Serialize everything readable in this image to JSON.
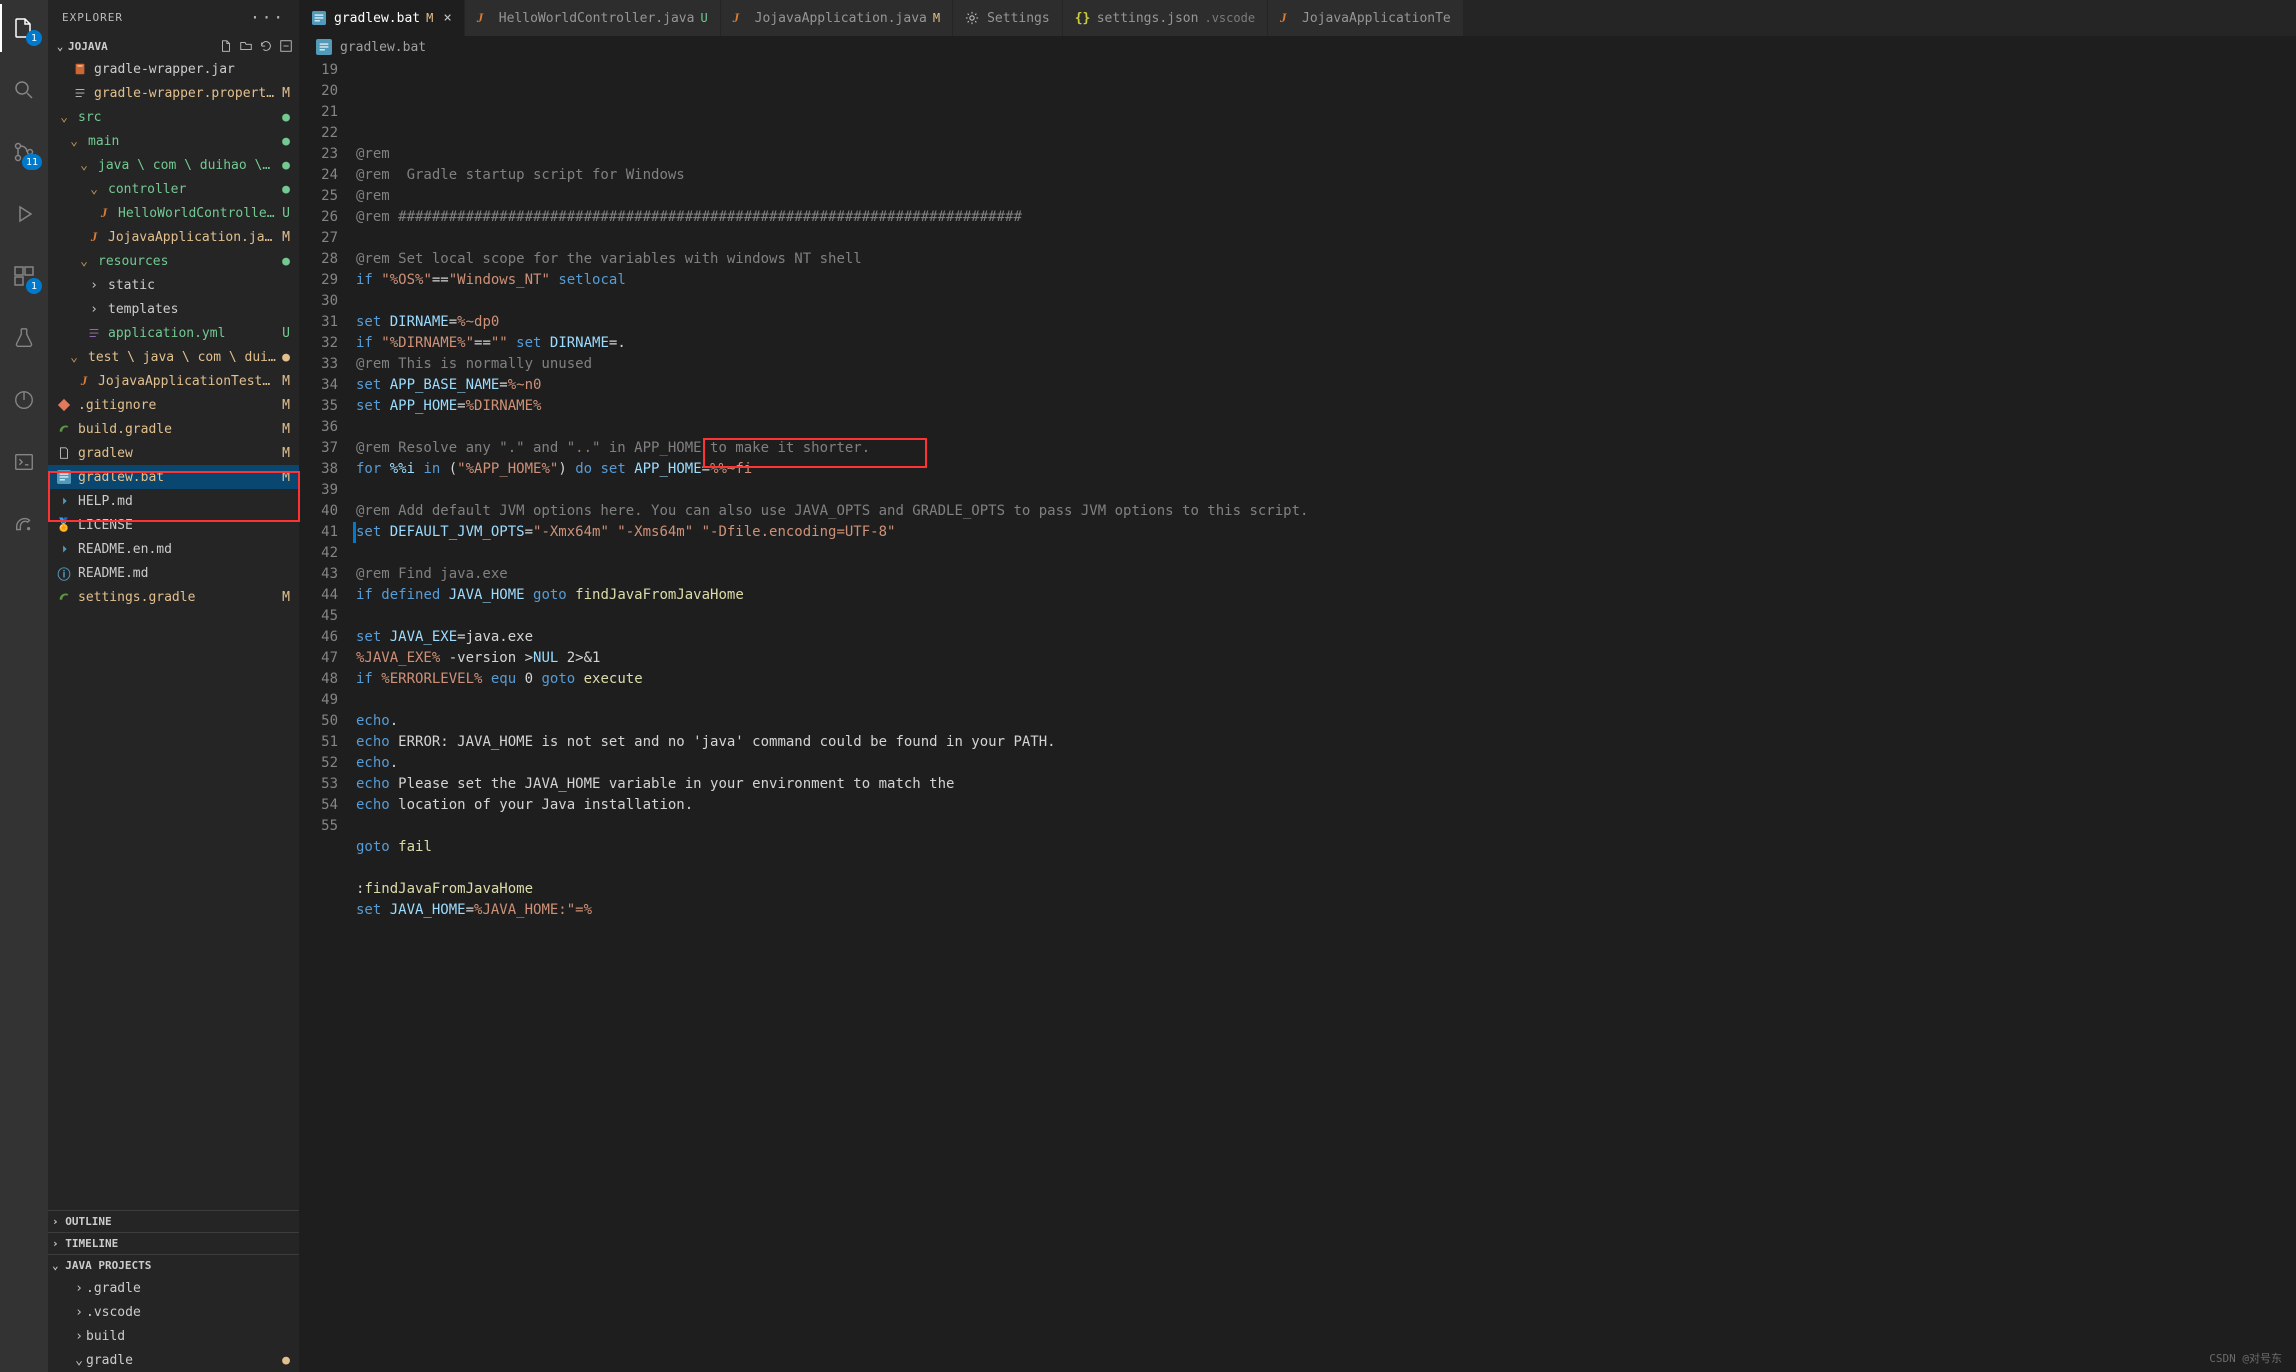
{
  "sidebar": {
    "title": "EXPLORER",
    "root": "JOJAVA",
    "tree": [
      {
        "label": "gradle-wrapper.jar",
        "icon": "jar",
        "status": "",
        "cls": ""
      },
      {
        "label": "gradle-wrapper.properties",
        "icon": "props",
        "status": "M",
        "cls": "file-yellow"
      },
      {
        "label": "src",
        "icon": "folder-o",
        "status": "dotA",
        "cls": "folder-name green"
      },
      {
        "label": "main",
        "icon": "folder-o",
        "status": "dotA",
        "cls": "folder-name green"
      },
      {
        "label": "java \\ com \\ duihao \\ joja...",
        "icon": "folder-o",
        "status": "dotA",
        "cls": "folder-name green"
      },
      {
        "label": "controller",
        "icon": "folder-o",
        "status": "dotA",
        "cls": "folder-name green"
      },
      {
        "label": "HelloWorldController....",
        "icon": "java",
        "status": "U",
        "cls": "file-green"
      },
      {
        "label": "JojavaApplication.java",
        "icon": "java",
        "status": "M",
        "cls": "file-yellow"
      },
      {
        "label": "resources",
        "icon": "folder-o",
        "status": "dotA",
        "cls": "folder-name green"
      },
      {
        "label": "static",
        "icon": "folder-c",
        "status": "",
        "cls": ""
      },
      {
        "label": "templates",
        "icon": "folder-c",
        "status": "",
        "cls": ""
      },
      {
        "label": "application.yml",
        "icon": "yml",
        "status": "U",
        "cls": "file-green"
      },
      {
        "label": "test \\ java \\ com \\ duihao \\ ...",
        "icon": "folder-o",
        "status": "dotM",
        "cls": "folder-name yellow"
      },
      {
        "label": "JojavaApplicationTests.j...",
        "icon": "java",
        "status": "M",
        "cls": "file-yellow"
      },
      {
        "label": ".gitignore",
        "icon": "git",
        "status": "M",
        "cls": "file-yellow"
      },
      {
        "label": "build.gradle",
        "icon": "gradle",
        "status": "M",
        "cls": "file-yellow"
      },
      {
        "label": "gradlew",
        "icon": "file",
        "status": "M",
        "cls": "file-yellow"
      },
      {
        "label": "gradlew.bat",
        "icon": "bat",
        "status": "M",
        "cls": "file-yellow",
        "selected": true
      },
      {
        "label": "HELP.md",
        "icon": "md",
        "status": "",
        "cls": ""
      },
      {
        "label": "LICENSE",
        "icon": "lic",
        "status": "",
        "cls": ""
      },
      {
        "label": "README.en.md",
        "icon": "md",
        "status": "",
        "cls": ""
      },
      {
        "label": "README.md",
        "icon": "md-i",
        "status": "",
        "cls": ""
      },
      {
        "label": "settings.gradle",
        "icon": "gradle",
        "status": "M",
        "cls": "file-yellow"
      }
    ],
    "panels": [
      "OUTLINE",
      "TIMELINE",
      "JAVA PROJECTS"
    ],
    "java_projects": [
      ".gradle",
      ".vscode",
      "build",
      "gradle"
    ]
  },
  "tabs": [
    {
      "icon": "bat",
      "label": "gradlew.bat",
      "git": "M",
      "active": true,
      "close": true
    },
    {
      "icon": "java",
      "label": "HelloWorldController.java",
      "git": "U"
    },
    {
      "icon": "java",
      "label": "JojavaApplication.java",
      "git": "M"
    },
    {
      "icon": "gear",
      "label": "Settings"
    },
    {
      "icon": "json",
      "label": "settings.json",
      "suffix": ".vscode"
    },
    {
      "icon": "java",
      "label": "JojavaApplicationTe"
    }
  ],
  "breadcrumb": {
    "icon": "bat",
    "label": "gradlew.bat"
  },
  "code": {
    "start": 19,
    "lines": [
      [
        [
          "@rem",
          "tk-rem"
        ]
      ],
      [
        [
          "@rem",
          "tk-rem"
        ],
        [
          "  Gradle startup script for Windows",
          "tk-rem-h"
        ]
      ],
      [
        [
          "@rem",
          "tk-rem"
        ]
      ],
      [
        [
          "@rem",
          "tk-rem"
        ],
        [
          " ##########################################################################",
          "tk-rem-h"
        ]
      ],
      [
        [
          "",
          "tk-plain"
        ]
      ],
      [
        [
          "@rem",
          "tk-rem"
        ],
        [
          " Set local scope for the variables with windows NT shell",
          "tk-rem-h"
        ]
      ],
      [
        [
          "if ",
          "tk-kw"
        ],
        [
          "\"%OS%\"",
          "tk-str"
        ],
        [
          "==",
          "tk-plain"
        ],
        [
          "\"Windows_NT\"",
          "tk-str"
        ],
        [
          " setlocal",
          "tk-kw"
        ]
      ],
      [
        [
          "",
          "tk-plain"
        ]
      ],
      [
        [
          "set ",
          "tk-kw"
        ],
        [
          "DIRNAME",
          "tk-var"
        ],
        [
          "=",
          "tk-plain"
        ],
        [
          "%~dp0",
          "tk-str"
        ]
      ],
      [
        [
          "if ",
          "tk-kw"
        ],
        [
          "\"%DIRNAME%\"",
          "tk-str"
        ],
        [
          "==",
          "tk-plain"
        ],
        [
          "\"\"",
          "tk-str"
        ],
        [
          " set ",
          "tk-kw"
        ],
        [
          "DIRNAME",
          "tk-var"
        ],
        [
          "=.",
          "tk-plain"
        ]
      ],
      [
        [
          "@rem",
          "tk-rem"
        ],
        [
          " This is normally unused",
          "tk-rem-h"
        ]
      ],
      [
        [
          "set ",
          "tk-kw"
        ],
        [
          "APP_BASE_NAME",
          "tk-var"
        ],
        [
          "=",
          "tk-plain"
        ],
        [
          "%~n0",
          "tk-str"
        ]
      ],
      [
        [
          "set ",
          "tk-kw"
        ],
        [
          "APP_HOME",
          "tk-var"
        ],
        [
          "=",
          "tk-plain"
        ],
        [
          "%DIRNAME%",
          "tk-str"
        ]
      ],
      [
        [
          "",
          "tk-plain"
        ]
      ],
      [
        [
          "@rem",
          "tk-rem"
        ],
        [
          " Resolve any \".\" and \"..\" in APP_HOME to make it shorter.",
          "tk-rem-h"
        ]
      ],
      [
        [
          "for ",
          "tk-kw"
        ],
        [
          "%%i",
          "tk-var"
        ],
        [
          " in ",
          "tk-kw"
        ],
        [
          "(",
          "tk-plain"
        ],
        [
          "\"%APP_HOME%\"",
          "tk-str"
        ],
        [
          ") ",
          "tk-plain"
        ],
        [
          "do ",
          "tk-kw"
        ],
        [
          "set ",
          "tk-kw"
        ],
        [
          "APP_HOME",
          "tk-var"
        ],
        [
          "=",
          "tk-plain"
        ],
        [
          "%%~fi",
          "tk-str"
        ]
      ],
      [
        [
          "",
          "tk-plain"
        ]
      ],
      [
        [
          "@rem",
          "tk-rem"
        ],
        [
          " Add default JVM options here. You can also use JAVA_OPTS and GRADLE_OPTS to pass JVM options to this script.",
          "tk-rem-h"
        ]
      ],
      [
        [
          "set ",
          "tk-kw"
        ],
        [
          "DEFAULT_JVM_OPTS",
          "tk-var"
        ],
        [
          "=",
          "tk-plain"
        ],
        [
          "\"-Xmx64m\" \"-Xms64m\" \"-Dfile.encoding=UTF-8\"",
          "tk-str"
        ]
      ],
      [
        [
          "",
          "tk-plain"
        ]
      ],
      [
        [
          "@rem",
          "tk-rem"
        ],
        [
          " Find java.exe",
          "tk-rem-h"
        ]
      ],
      [
        [
          "if ",
          "tk-kw"
        ],
        [
          "defined ",
          "tk-kw"
        ],
        [
          "JAVA_HOME",
          "tk-var"
        ],
        [
          " goto ",
          "tk-kw"
        ],
        [
          "findJavaFromJavaHome",
          "tk-fn"
        ]
      ],
      [
        [
          "",
          "tk-plain"
        ]
      ],
      [
        [
          "set ",
          "tk-kw"
        ],
        [
          "JAVA_EXE",
          "tk-var"
        ],
        [
          "=java.exe",
          "tk-plain"
        ]
      ],
      [
        [
          "%JAVA_EXE%",
          "tk-str"
        ],
        [
          " -version >",
          "tk-plain"
        ],
        [
          "NUL",
          "tk-var"
        ],
        [
          " 2>&1",
          "tk-plain"
        ]
      ],
      [
        [
          "if ",
          "tk-kw"
        ],
        [
          "%ERRORLEVEL%",
          "tk-str"
        ],
        [
          " equ ",
          "tk-kw"
        ],
        [
          "0",
          "tk-plain"
        ],
        [
          " goto ",
          "tk-kw"
        ],
        [
          "execute",
          "tk-fn"
        ]
      ],
      [
        [
          "",
          "tk-plain"
        ]
      ],
      [
        [
          "echo",
          "tk-kw"
        ],
        [
          ".",
          "tk-plain"
        ]
      ],
      [
        [
          "echo ",
          "tk-kw"
        ],
        [
          "ERROR: JAVA_HOME is not set and no 'java' command could be found in your PATH.",
          "tk-plain"
        ]
      ],
      [
        [
          "echo",
          "tk-kw"
        ],
        [
          ".",
          "tk-plain"
        ]
      ],
      [
        [
          "echo ",
          "tk-kw"
        ],
        [
          "Please set the JAVA_HOME variable in your environment to match the",
          "tk-plain"
        ]
      ],
      [
        [
          "echo ",
          "tk-kw"
        ],
        [
          "location of your Java installation.",
          "tk-plain"
        ]
      ],
      [
        [
          "",
          "tk-plain"
        ]
      ],
      [
        [
          "goto ",
          "tk-kw"
        ],
        [
          "fail",
          "tk-fn"
        ]
      ],
      [
        [
          "",
          "tk-plain"
        ]
      ],
      [
        [
          ":",
          "tk-plain"
        ],
        [
          "findJavaFromJavaHome",
          "tk-fn"
        ]
      ],
      [
        [
          "set ",
          "tk-kw"
        ],
        [
          "JAVA_HOME",
          "tk-var"
        ],
        [
          "=",
          "tk-plain"
        ],
        [
          "%JAVA_HOME:\"=%",
          "tk-str"
        ]
      ]
    ]
  },
  "activity_badges": {
    "files": "1",
    "scm": "11",
    "ext": "1"
  },
  "watermark": "CSDN @对号东"
}
